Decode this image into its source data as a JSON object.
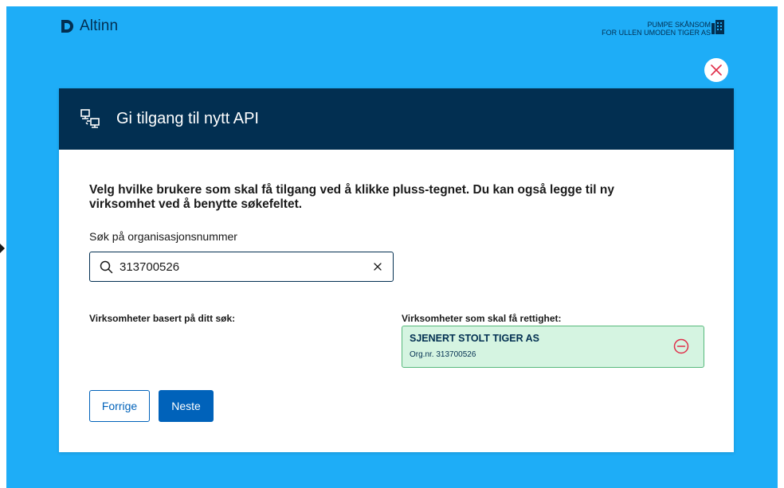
{
  "header": {
    "brand": "Altinn",
    "user_name": "PUMPE SKÅNSOM",
    "user_org": "for ULLEN UMODEN TIGER AS"
  },
  "modal": {
    "title": "Gi tilgang til nytt API",
    "intro": "Velg hvilke brukere som skal få tilgang ved å klikke pluss-tegnet. Du kan også legge til ny virksomhet ved å benytte søkefeltet.",
    "search": {
      "label": "Søk på organisasjonsnummer",
      "value": "313700526"
    },
    "results_label": "Virksomheter basert på ditt søk:",
    "selected_label": "Virksomheter som skal få rettighet:",
    "selected": [
      {
        "name": "SJENERT STOLT TIGER AS",
        "org_nr": "Org.nr. 313700526"
      }
    ],
    "buttons": {
      "previous": "Forrige",
      "next": "Neste"
    }
  },
  "colors": {
    "background": "#1eadf7",
    "header_dark": "#022f51",
    "primary": "#0062ba",
    "success_bg": "#d5f4e1",
    "danger": "#e02e49"
  }
}
